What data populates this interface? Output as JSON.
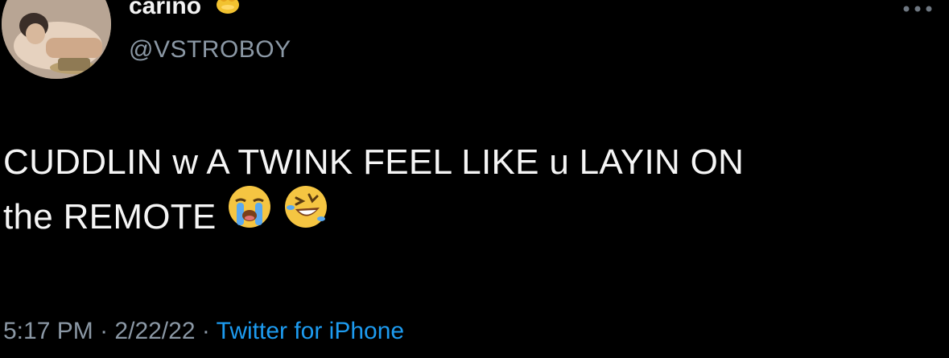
{
  "author": {
    "display_name": "cariño",
    "handle": "@VSTROBOY",
    "name_emoji_icon": "honey-pot-emoji"
  },
  "tweet": {
    "line1": "CUDDLIN w A TWINK FEEL LIKE u LAYIN ON",
    "line2": "the REMOTE",
    "emojis": [
      "crying-face-emoji",
      "rolling-on-floor-laughing-emoji"
    ]
  },
  "meta": {
    "time": "5:17 PM",
    "separator": "·",
    "date": "2/22/22",
    "source": "Twitter for iPhone"
  },
  "colors": {
    "background": "#000000",
    "text": "#f5f5f5",
    "secondary": "#8b98a5",
    "link": "#1d9bf0"
  }
}
